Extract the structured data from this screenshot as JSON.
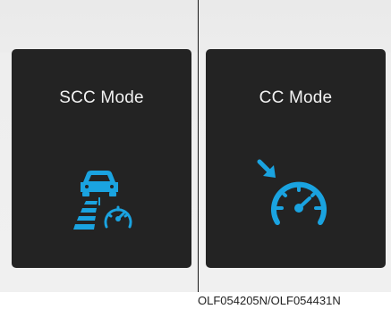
{
  "panels": {
    "scc": {
      "title": "SCC Mode",
      "icon": "smart-cruise-control-icon"
    },
    "cc": {
      "title": "CC Mode",
      "icon": "cruise-control-speedometer-icon"
    }
  },
  "figure_code": "OLF054205N/OLF054431N",
  "colors": {
    "panel_background": "#232323",
    "icon_accent": "#1aa3e0",
    "title_text": "#f2f2f2"
  }
}
